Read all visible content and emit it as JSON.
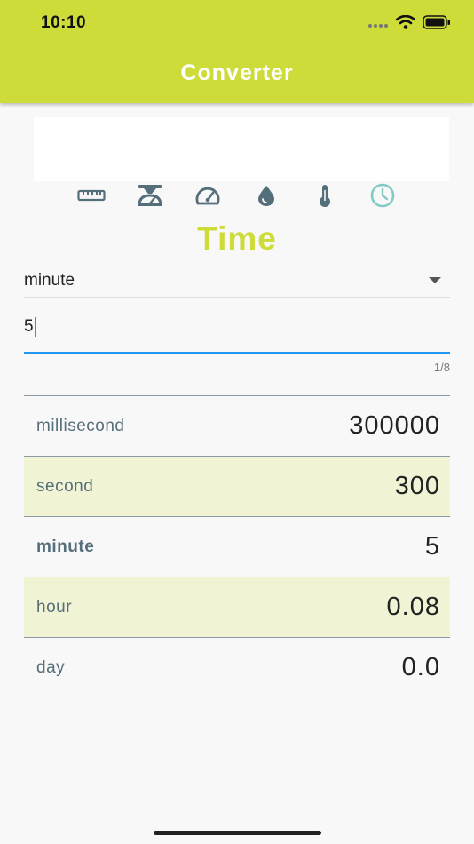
{
  "status_bar": {
    "time": "10:10"
  },
  "app_bar": {
    "title": "Converter",
    "background_color": "#cddc39"
  },
  "categories": [
    {
      "name": "length",
      "icon": "ruler-icon",
      "active": false
    },
    {
      "name": "mass",
      "icon": "scale-icon",
      "active": false
    },
    {
      "name": "speed",
      "icon": "speedometer-icon",
      "active": false
    },
    {
      "name": "volume",
      "icon": "water-drop-icon",
      "active": false
    },
    {
      "name": "temperature",
      "icon": "thermometer-icon",
      "active": false
    },
    {
      "name": "time",
      "icon": "clock-icon",
      "active": true
    }
  ],
  "colors": {
    "accent": "#cddc39",
    "active_icon": "#80cbc4",
    "inactive_icon": "#546e7a",
    "input_focus": "#2196f3",
    "alt_row": "#f0f4d4"
  },
  "heading": "Time",
  "unit_select": {
    "value": "minute"
  },
  "value_input": {
    "value": "5",
    "counter": "1/8"
  },
  "results": [
    {
      "unit": "millisecond",
      "value": "300000",
      "selected": false
    },
    {
      "unit": "second",
      "value": "300",
      "selected": false
    },
    {
      "unit": "minute",
      "value": "5",
      "selected": true
    },
    {
      "unit": "hour",
      "value": "0.08",
      "selected": false
    },
    {
      "unit": "day",
      "value": "0.0",
      "selected": false
    }
  ]
}
